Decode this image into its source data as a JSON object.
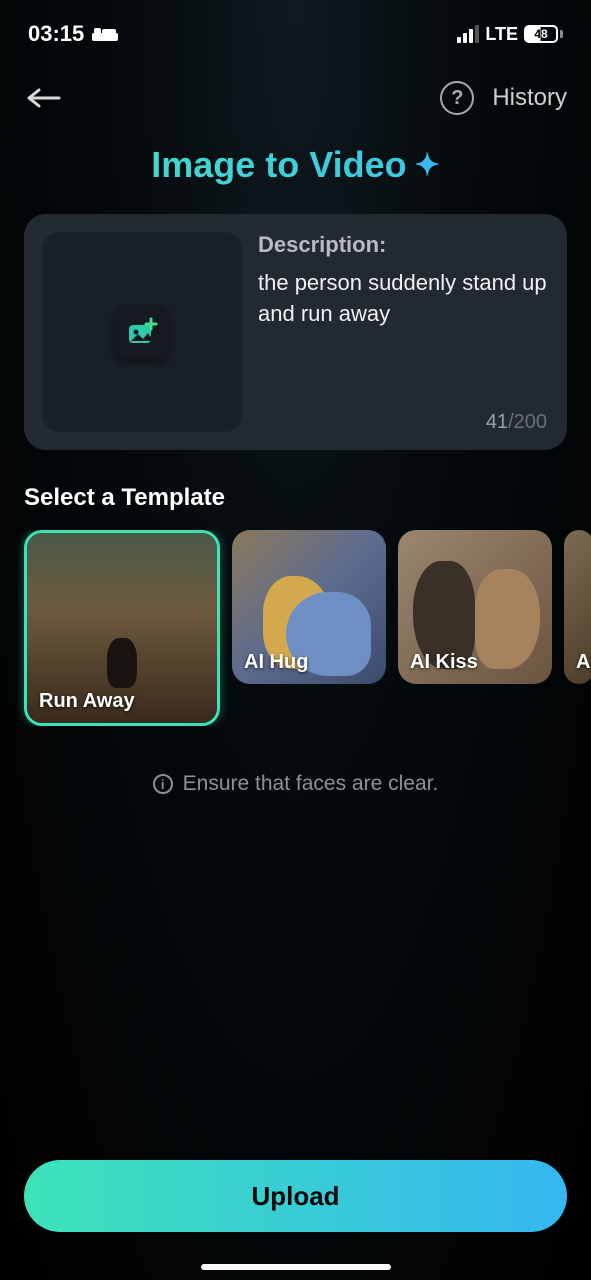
{
  "status": {
    "time": "03:15",
    "network": "LTE",
    "battery": "48"
  },
  "nav": {
    "history": "History"
  },
  "title": "Image to Video",
  "description": {
    "label": "Description:",
    "text": "the person suddenly stand up and run away",
    "count": "41",
    "max": "200"
  },
  "templates": {
    "heading": "Select a Template",
    "items": [
      {
        "label": "Run Away",
        "selected": true
      },
      {
        "label": "AI Hug",
        "selected": false
      },
      {
        "label": "AI Kiss",
        "selected": false
      },
      {
        "label": "AI",
        "selected": false
      }
    ]
  },
  "hint": "Ensure that faces are clear.",
  "upload": "Upload"
}
